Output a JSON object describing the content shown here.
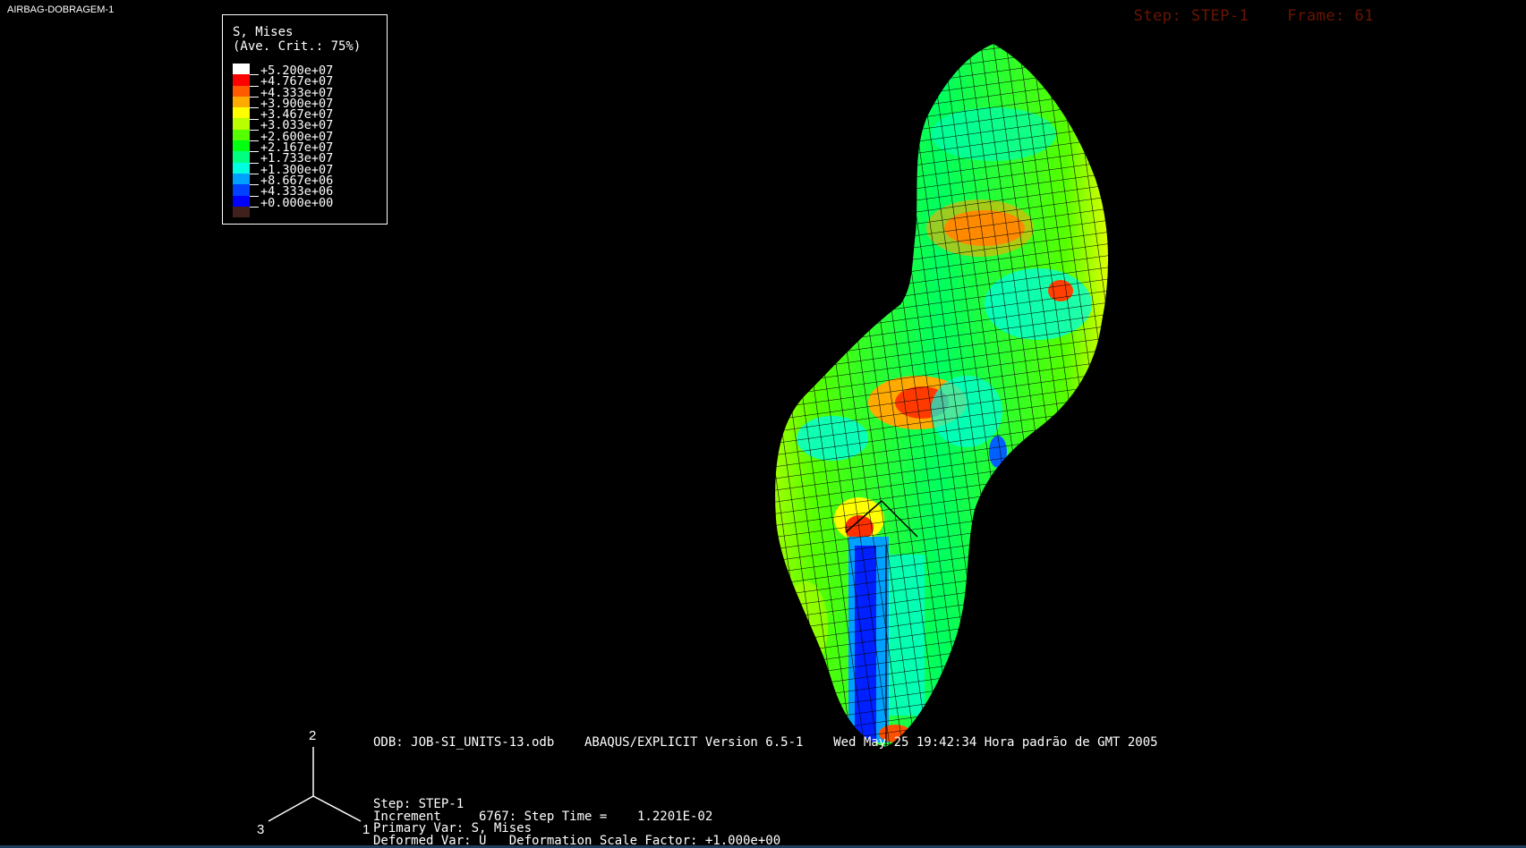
{
  "window": {
    "title": "AIRBAG-DOBRAGEM-1"
  },
  "status": {
    "step": "Step: STEP-1",
    "frame": "Frame: 61"
  },
  "legend": {
    "title_line1": "S, Mises",
    "title_line2": "(Ave. Crit.: 75%)",
    "colors": [
      "#ffffff",
      "#ff0000",
      "#ff5a00",
      "#ffaa00",
      "#ffff00",
      "#b8ff00",
      "#55ff00",
      "#00ff10",
      "#00ff80",
      "#00ffe0",
      "#00a0ff",
      "#0040ff",
      "#0000ff",
      "#40201a"
    ],
    "labels": [
      "+5.200e+07",
      "+4.767e+07",
      "+4.333e+07",
      "+3.900e+07",
      "+3.467e+07",
      "+3.033e+07",
      "+2.600e+07",
      "+2.167e+07",
      "+1.733e+07",
      "+1.300e+07",
      "+8.667e+06",
      "+4.333e+06",
      "+0.000e+00"
    ]
  },
  "triad": {
    "axis_y": "2",
    "axis_z": "3",
    "axis_x": "1"
  },
  "info": {
    "odb_line": "ODB: JOB-SI_UNITS-13.odb    ABAQUS/EXPLICIT Version 6.5-1    Wed May 25 19:42:34 Hora padrão de GMT 2005",
    "step_line": "Step: STEP-1",
    "increment_line": "Increment     6767: Step Time =    1.2201E-02",
    "primary_line": "Primary Var: S, Mises",
    "deformed_line": "Deformed Var: U   Deformation Scale Factor: +1.000e+00"
  },
  "colors": {
    "background": "#000000",
    "step_frame_text": "#6b1500",
    "mesh_line": "#000000"
  }
}
